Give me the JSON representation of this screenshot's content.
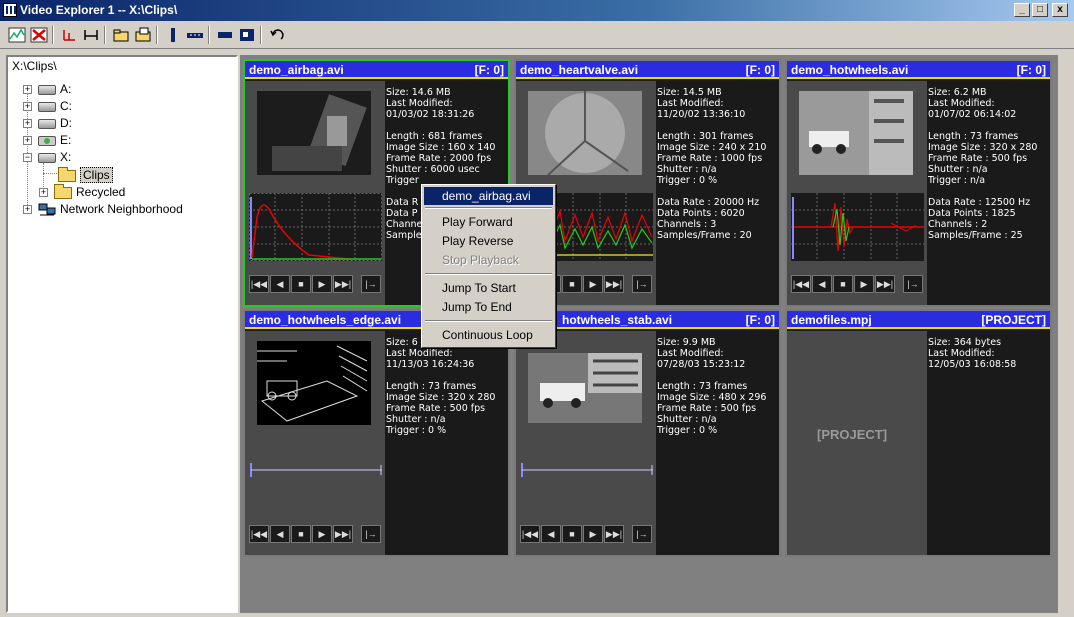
{
  "window": {
    "title": "Video Explorer 1 -- X:\\Clips\\",
    "minimize": "_",
    "maximize": "□",
    "close": "x"
  },
  "toolbar": {
    "icons": [
      "chart-icon",
      "delete-icon",
      "trim-start-icon",
      "trim-range-icon",
      "open-folder-icon",
      "save-icon",
      "single-view-icon",
      "strip-view-icon",
      "thumbnail-view-icon",
      "grid-view-icon",
      "undo-icon"
    ]
  },
  "tree": {
    "path": "X:\\Clips\\",
    "items": [
      {
        "label": "A:"
      },
      {
        "label": "C:"
      },
      {
        "label": "D:"
      },
      {
        "label": "E:"
      },
      {
        "label": "X:"
      },
      {
        "label": "Clips"
      },
      {
        "label": "Recycled"
      },
      {
        "label": "Network Neighborhood"
      }
    ]
  },
  "panels": [
    {
      "name": "demo_airbag.avi",
      "tag": "[F: 0]",
      "size": "Size: 14.6 MB",
      "modified_label": "Last Modified:",
      "modified": "01/03/02 18:31:26",
      "length": "Length : 681 frames",
      "image_size": "Image Size : 160 x 140",
      "frame_rate": "Frame Rate : 2000 fps",
      "shutter": "Shutter : 6000 usec",
      "trigger": "Trigger",
      "data_rate": "Data R",
      "data_points": "Data P",
      "channels": "Channe",
      "samples": "Samples"
    },
    {
      "name": "demo_heartvalve.avi",
      "tag": "[F: 0]",
      "size": "Size: 14.5 MB",
      "modified_label": "Last Modified:",
      "modified": "11/20/02 13:36:10",
      "length": "Length : 301 frames",
      "image_size": "Image Size : 240 x 210",
      "frame_rate": "Frame Rate : 1000 fps",
      "shutter": "Shutter : n/a",
      "trigger": "Trigger : 0 %",
      "data_rate": "Data Rate : 20000 Hz",
      "data_points": "Data Points : 6020",
      "channels": "Channels : 3",
      "samples": "Samples/Frame : 20"
    },
    {
      "name": "demo_hotwheels.avi",
      "tag": "[F: 0]",
      "size": "Size: 6.2 MB",
      "modified_label": "Last Modified:",
      "modified": "01/07/02 06:14:02",
      "length": "Length : 73 frames",
      "image_size": "Image Size : 320 x 280",
      "frame_rate": "Frame Rate : 500 fps",
      "shutter": "Shutter : n/a",
      "trigger": "Trigger : n/a",
      "data_rate": "Data Rate : 12500 Hz",
      "data_points": "Data Points : 1825",
      "channels": "Channels : 2",
      "samples": "Samples/Frame : 25"
    },
    {
      "name": "demo_hotwheels_edge.avi",
      "tag": "",
      "size": "Size: 6",
      "modified_label": "Last Modified:",
      "modified": "11/13/03 16:24:36",
      "length": "Length : 73 frames",
      "image_size": "Image Size : 320 x 280",
      "frame_rate": "Frame Rate : 500 fps",
      "shutter": "Shutter : n/a",
      "trigger": "Trigger : 0 %"
    },
    {
      "name": "hotwheels_stab.avi",
      "tag": "[F: 0]",
      "size": "Size: 9.9 MB",
      "modified_label": "Last Modified:",
      "modified": "07/28/03 15:23:12",
      "length": "Length : 73 frames",
      "image_size": "Image Size : 480 x 296",
      "frame_rate": "Frame Rate : 500 fps",
      "shutter": "Shutter : n/a",
      "trigger": "Trigger : 0 %"
    },
    {
      "name": "demofiles.mpj",
      "tag": "[PROJECT]",
      "size": "Size: 364 bytes",
      "modified_label": "Last Modified:",
      "modified": "12/05/03 16:08:58",
      "placeholder": "[PROJECT]"
    }
  ],
  "controls": [
    "|◀◀",
    "◀",
    "■",
    "▶",
    "▶▶|",
    "|→"
  ],
  "context_menu": {
    "items": [
      "demo_airbag.avi",
      "Play Forward",
      "Play Reverse",
      "Stop Playback",
      "Jump To Start",
      "Jump To End",
      "Continuous Loop"
    ]
  },
  "colors": {
    "header_bg": "#2b2be0",
    "header_underline": "#f0e000",
    "selected_border": "#22cc22",
    "menu_highlight": "#0a246a"
  }
}
